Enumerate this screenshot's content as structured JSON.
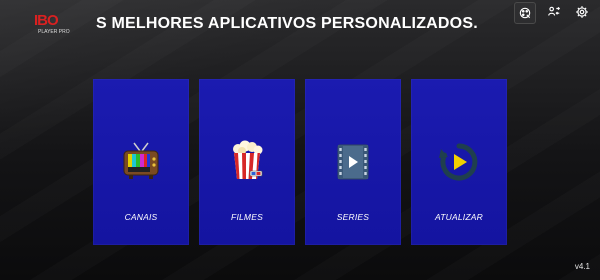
{
  "app": {
    "logo_text": "IBO",
    "logo_subtext": "PLAYER PRO",
    "headline": "S MELHORES APLICATIVOS PERSONALIZADOS.",
    "version": "v4.1"
  },
  "top_icons": [
    {
      "name": "palette-settings-icon"
    },
    {
      "name": "user-switch-icon"
    },
    {
      "name": "gear-icon"
    }
  ],
  "cards": [
    {
      "label": "CANAIS",
      "icon": "tv-icon"
    },
    {
      "label": "FILMES",
      "icon": "popcorn-icon"
    },
    {
      "label": "SERIES",
      "icon": "film-play-icon"
    },
    {
      "label": "ATUALIZAR",
      "icon": "refresh-play-icon"
    }
  ],
  "colors": {
    "card_blue": "#1717a8",
    "background": "#141416",
    "logo_red": "#d92121"
  }
}
